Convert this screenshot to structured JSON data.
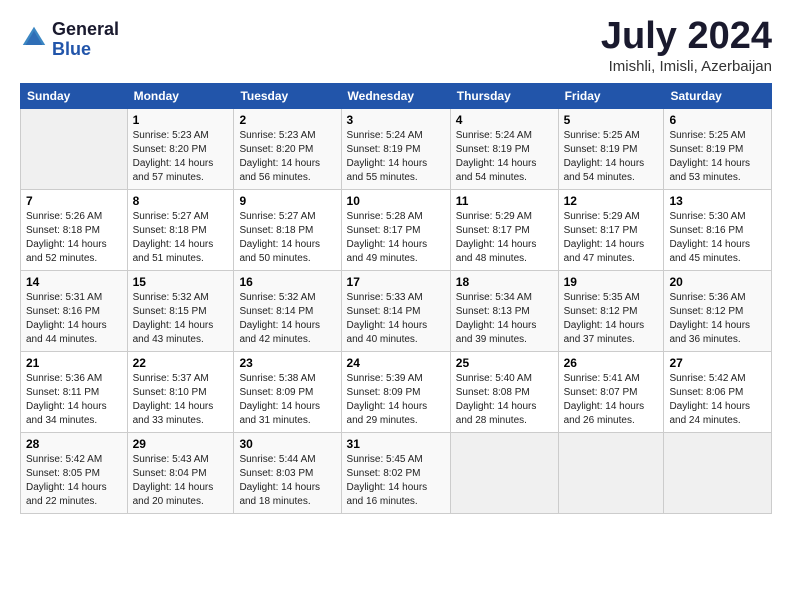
{
  "header": {
    "logo_general": "General",
    "logo_blue": "Blue",
    "title": "July 2024",
    "location": "Imishli, Imisli, Azerbaijan"
  },
  "days_of_week": [
    "Sunday",
    "Monday",
    "Tuesday",
    "Wednesday",
    "Thursday",
    "Friday",
    "Saturday"
  ],
  "weeks": [
    [
      {
        "day": "",
        "content": ""
      },
      {
        "day": "1",
        "content": "Sunrise: 5:23 AM\nSunset: 8:20 PM\nDaylight: 14 hours\nand 57 minutes."
      },
      {
        "day": "2",
        "content": "Sunrise: 5:23 AM\nSunset: 8:20 PM\nDaylight: 14 hours\nand 56 minutes."
      },
      {
        "day": "3",
        "content": "Sunrise: 5:24 AM\nSunset: 8:19 PM\nDaylight: 14 hours\nand 55 minutes."
      },
      {
        "day": "4",
        "content": "Sunrise: 5:24 AM\nSunset: 8:19 PM\nDaylight: 14 hours\nand 54 minutes."
      },
      {
        "day": "5",
        "content": "Sunrise: 5:25 AM\nSunset: 8:19 PM\nDaylight: 14 hours\nand 54 minutes."
      },
      {
        "day": "6",
        "content": "Sunrise: 5:25 AM\nSunset: 8:19 PM\nDaylight: 14 hours\nand 53 minutes."
      }
    ],
    [
      {
        "day": "7",
        "content": "Sunrise: 5:26 AM\nSunset: 8:18 PM\nDaylight: 14 hours\nand 52 minutes."
      },
      {
        "day": "8",
        "content": "Sunrise: 5:27 AM\nSunset: 8:18 PM\nDaylight: 14 hours\nand 51 minutes."
      },
      {
        "day": "9",
        "content": "Sunrise: 5:27 AM\nSunset: 8:18 PM\nDaylight: 14 hours\nand 50 minutes."
      },
      {
        "day": "10",
        "content": "Sunrise: 5:28 AM\nSunset: 8:17 PM\nDaylight: 14 hours\nand 49 minutes."
      },
      {
        "day": "11",
        "content": "Sunrise: 5:29 AM\nSunset: 8:17 PM\nDaylight: 14 hours\nand 48 minutes."
      },
      {
        "day": "12",
        "content": "Sunrise: 5:29 AM\nSunset: 8:17 PM\nDaylight: 14 hours\nand 47 minutes."
      },
      {
        "day": "13",
        "content": "Sunrise: 5:30 AM\nSunset: 8:16 PM\nDaylight: 14 hours\nand 45 minutes."
      }
    ],
    [
      {
        "day": "14",
        "content": "Sunrise: 5:31 AM\nSunset: 8:16 PM\nDaylight: 14 hours\nand 44 minutes."
      },
      {
        "day": "15",
        "content": "Sunrise: 5:32 AM\nSunset: 8:15 PM\nDaylight: 14 hours\nand 43 minutes."
      },
      {
        "day": "16",
        "content": "Sunrise: 5:32 AM\nSunset: 8:14 PM\nDaylight: 14 hours\nand 42 minutes."
      },
      {
        "day": "17",
        "content": "Sunrise: 5:33 AM\nSunset: 8:14 PM\nDaylight: 14 hours\nand 40 minutes."
      },
      {
        "day": "18",
        "content": "Sunrise: 5:34 AM\nSunset: 8:13 PM\nDaylight: 14 hours\nand 39 minutes."
      },
      {
        "day": "19",
        "content": "Sunrise: 5:35 AM\nSunset: 8:12 PM\nDaylight: 14 hours\nand 37 minutes."
      },
      {
        "day": "20",
        "content": "Sunrise: 5:36 AM\nSunset: 8:12 PM\nDaylight: 14 hours\nand 36 minutes."
      }
    ],
    [
      {
        "day": "21",
        "content": "Sunrise: 5:36 AM\nSunset: 8:11 PM\nDaylight: 14 hours\nand 34 minutes."
      },
      {
        "day": "22",
        "content": "Sunrise: 5:37 AM\nSunset: 8:10 PM\nDaylight: 14 hours\nand 33 minutes."
      },
      {
        "day": "23",
        "content": "Sunrise: 5:38 AM\nSunset: 8:09 PM\nDaylight: 14 hours\nand 31 minutes."
      },
      {
        "day": "24",
        "content": "Sunrise: 5:39 AM\nSunset: 8:09 PM\nDaylight: 14 hours\nand 29 minutes."
      },
      {
        "day": "25",
        "content": "Sunrise: 5:40 AM\nSunset: 8:08 PM\nDaylight: 14 hours\nand 28 minutes."
      },
      {
        "day": "26",
        "content": "Sunrise: 5:41 AM\nSunset: 8:07 PM\nDaylight: 14 hours\nand 26 minutes."
      },
      {
        "day": "27",
        "content": "Sunrise: 5:42 AM\nSunset: 8:06 PM\nDaylight: 14 hours\nand 24 minutes."
      }
    ],
    [
      {
        "day": "28",
        "content": "Sunrise: 5:42 AM\nSunset: 8:05 PM\nDaylight: 14 hours\nand 22 minutes."
      },
      {
        "day": "29",
        "content": "Sunrise: 5:43 AM\nSunset: 8:04 PM\nDaylight: 14 hours\nand 20 minutes."
      },
      {
        "day": "30",
        "content": "Sunrise: 5:44 AM\nSunset: 8:03 PM\nDaylight: 14 hours\nand 18 minutes."
      },
      {
        "day": "31",
        "content": "Sunrise: 5:45 AM\nSunset: 8:02 PM\nDaylight: 14 hours\nand 16 minutes."
      },
      {
        "day": "",
        "content": ""
      },
      {
        "day": "",
        "content": ""
      },
      {
        "day": "",
        "content": ""
      }
    ]
  ]
}
